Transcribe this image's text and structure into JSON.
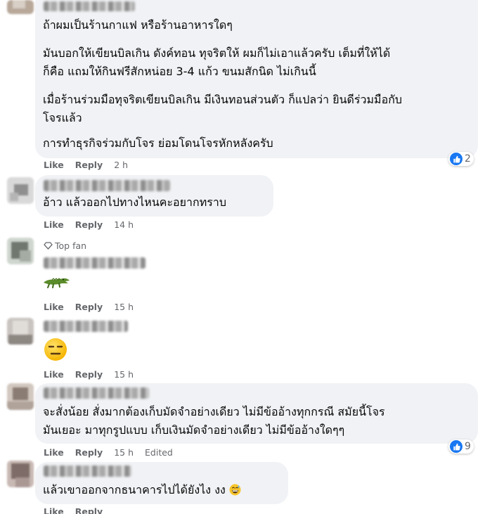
{
  "comments": [
    {
      "lines": [
        "ถ้าผมเป็นร้านกาแฟ หรือร้านอาหารใดๆ",
        "มันบอกให้เขียนบิลเกิน ดังค์ทอน ทุจริตให้ ผมก็ไม่เอาแล้วครับ เต็มที่ให้ได้",
        "ก็คือ แถมให้กินฟรีสักหน่อย 3-4 แก้ว ขนมสักนิด ไม่เกินนี้",
        "เมื่อร้านร่วมมือทุจริตเขียนบิลเกิน มีเงินทอนส่วนตัว ก็แปลว่า ยินดีร่วมมือกับ",
        "โจรแล้ว",
        "การทำธุรกิจร่วมกับโจร ย่อมโดนโจรหักหลังครับ"
      ],
      "like": "Like",
      "reply": "Reply",
      "time": "2 h",
      "reaction_count": "2"
    },
    {
      "lines": [
        "อ้าว แล้วออกไปทางไหนคะอยากทราบ"
      ],
      "like": "Like",
      "reply": "Reply",
      "time": "14 h"
    },
    {
      "badge": "Top fan",
      "like": "Like",
      "reply": "Reply",
      "time": "15 h",
      "sticker": "crocodile-emoji"
    },
    {
      "like": "Like",
      "reply": "Reply",
      "time": "15 h",
      "sticker": "expressionless-face-emoji"
    },
    {
      "lines": [
        "จะสั่งน้อย สั่งมากต้องเก็บมัดจำอย่างเดียว ไม่มีข้ออ้างทุกกรณี สมัยนี้โจร",
        "มันเยอะ มาทุกรูปแบบ เก็บเงินมัดจำอย่างเดียว ไม่มีข้ออ้างใดๆๆ"
      ],
      "like": "Like",
      "reply": "Reply",
      "time": "15 h",
      "edited": "Edited",
      "reaction_count": "9"
    },
    {
      "lines": [
        "แล้วเขาออกจากธนาคารไปได้ยังไง งง"
      ],
      "like": "Like",
      "reply": "Reply"
    }
  ],
  "colors": {
    "bubble": "#f0f2f5",
    "meta": "#65676b",
    "text": "#050505",
    "like_blue": "#1877f2"
  }
}
